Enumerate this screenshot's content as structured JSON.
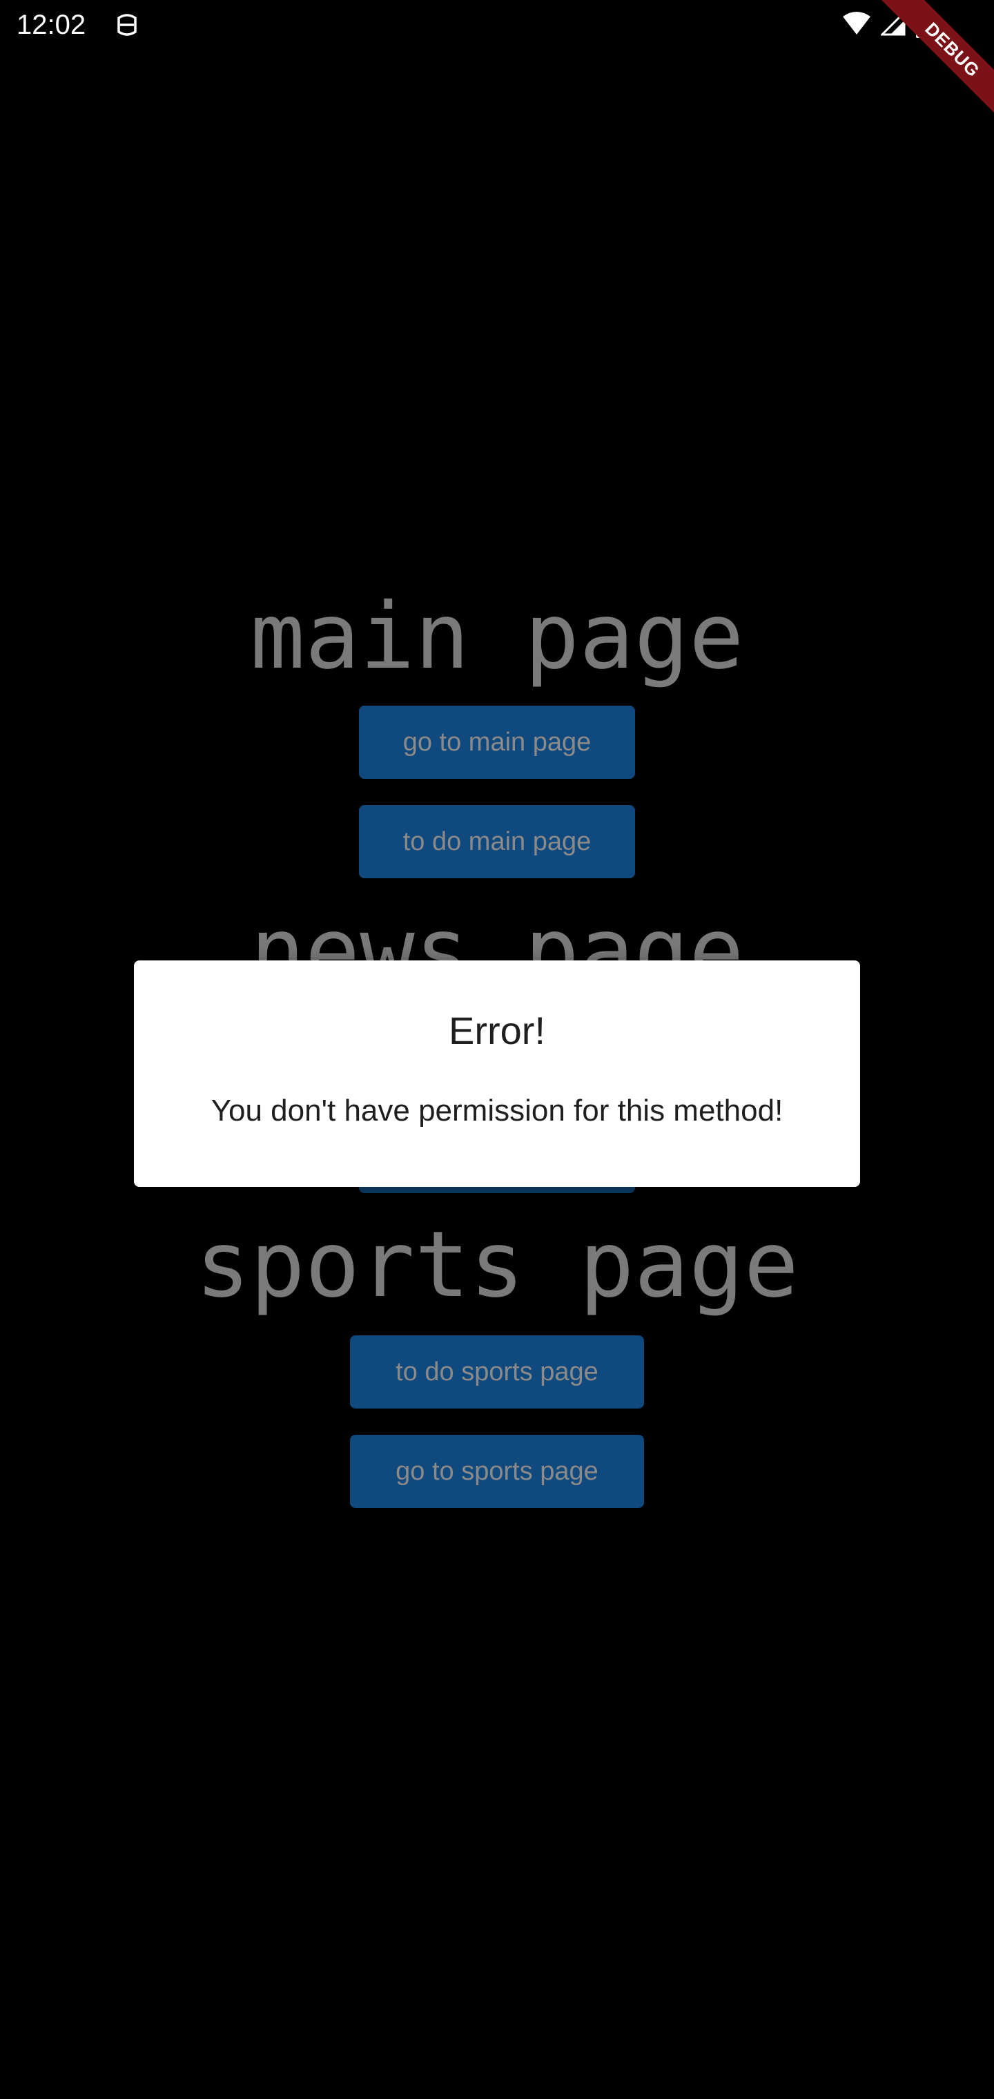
{
  "status_bar": {
    "time": "12:02",
    "notification_icon": "notification-badge-icon",
    "icons": [
      "wifi-icon",
      "cell-signal-icon",
      "battery-icon"
    ]
  },
  "debug_banner": {
    "label": "DEBUG"
  },
  "sections": {
    "main": {
      "title": "main page",
      "go_button": "go to main page",
      "todo_button": "to do main page"
    },
    "news": {
      "title": "news page"
    },
    "sports": {
      "title": "sports page",
      "todo_button": "to do sports page",
      "go_button": "go to sports page"
    }
  },
  "dialog": {
    "title": "Error!",
    "message": "You don't have permission for this method!"
  },
  "colors": {
    "background": "#000000",
    "button": "#10497d",
    "dimmed_text": "#7a7a7a",
    "dialog_bg": "#ffffff",
    "debug_ribbon": "#7a1218"
  }
}
